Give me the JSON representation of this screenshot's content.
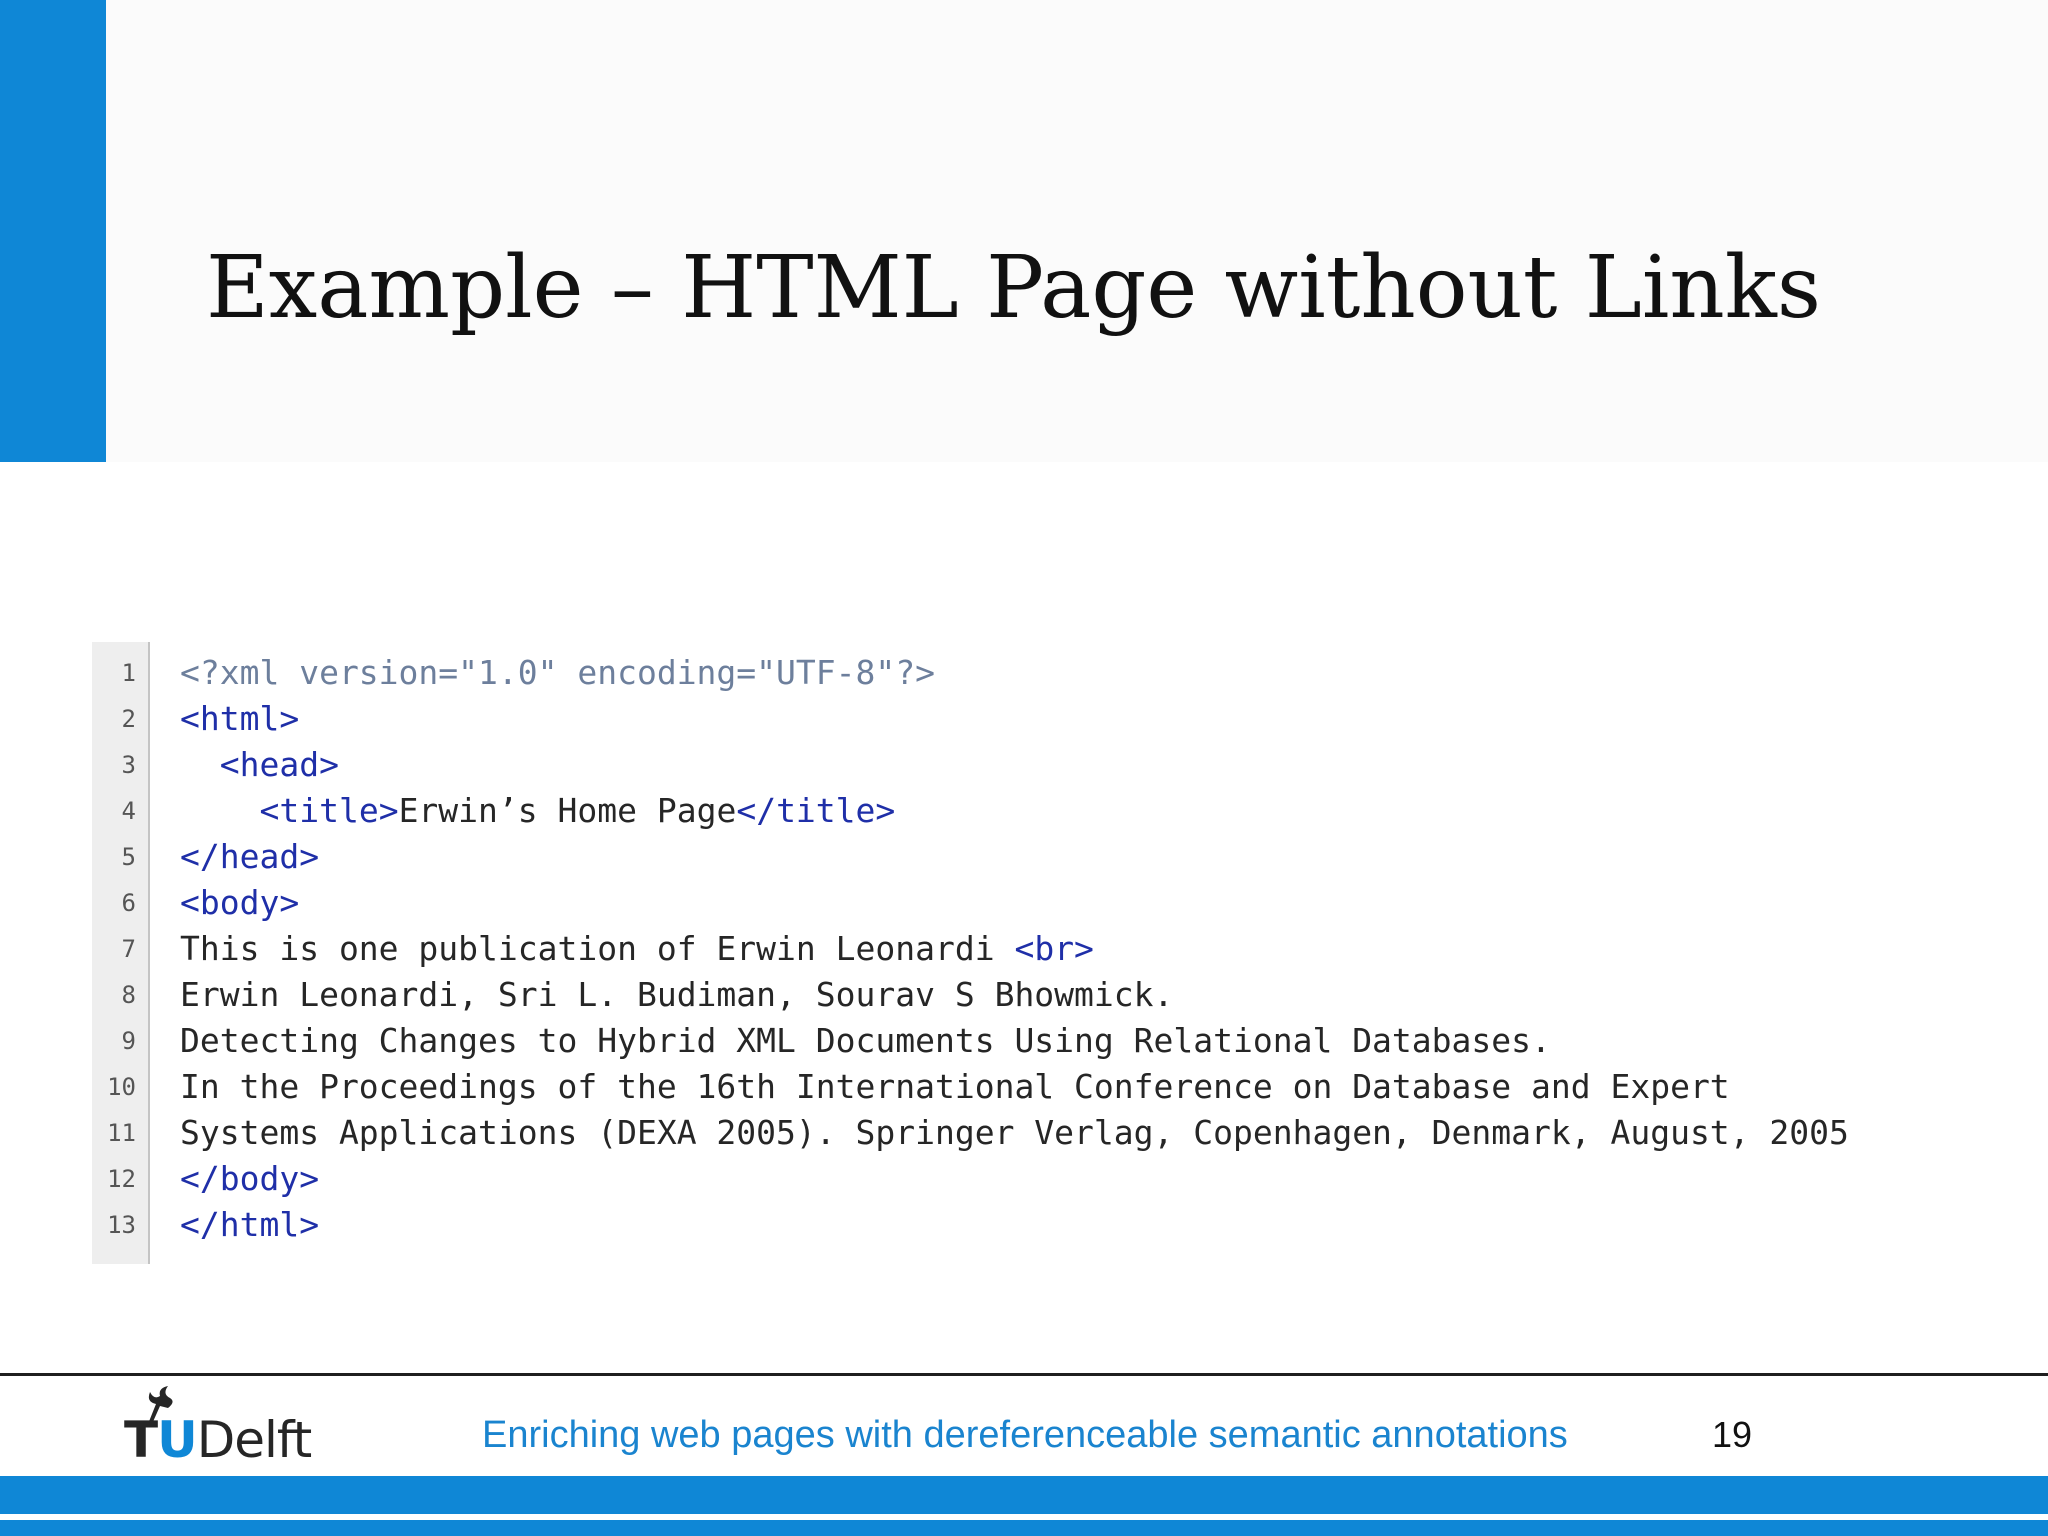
{
  "slide": {
    "title": "Example – HTML Page without Links",
    "accent_color": "#0f87d6"
  },
  "code": {
    "lines": [
      {
        "num": "1",
        "tokens": [
          {
            "t": "decl",
            "v": "<?xml version=\"1.0\" encoding=\"UTF-8\"?>"
          }
        ]
      },
      {
        "num": "2",
        "tokens": [
          {
            "t": "tag",
            "v": "<html>"
          }
        ]
      },
      {
        "num": "3",
        "tokens": [
          {
            "t": "text",
            "v": "  "
          },
          {
            "t": "tag",
            "v": "<head>"
          }
        ]
      },
      {
        "num": "4",
        "tokens": [
          {
            "t": "text",
            "v": "    "
          },
          {
            "t": "tag",
            "v": "<title>"
          },
          {
            "t": "text",
            "v": "Erwin’s Home Page"
          },
          {
            "t": "tag",
            "v": "</title>"
          }
        ]
      },
      {
        "num": "5",
        "tokens": [
          {
            "t": "tag",
            "v": "</head>"
          }
        ]
      },
      {
        "num": "6",
        "tokens": [
          {
            "t": "tag",
            "v": "<body>"
          }
        ]
      },
      {
        "num": "7",
        "tokens": [
          {
            "t": "text",
            "v": "This is one publication of Erwin Leonardi "
          },
          {
            "t": "tag",
            "v": "<br>"
          }
        ]
      },
      {
        "num": "8",
        "tokens": [
          {
            "t": "text",
            "v": "Erwin Leonardi, Sri L. Budiman, Sourav S Bhowmick."
          }
        ]
      },
      {
        "num": "9",
        "tokens": [
          {
            "t": "text",
            "v": "Detecting Changes to Hybrid XML Documents Using Relational Databases."
          }
        ]
      },
      {
        "num": "10",
        "tokens": [
          {
            "t": "text",
            "v": "In the Proceedings of the 16th International Conference on Database and Expert"
          }
        ]
      },
      {
        "num": "11",
        "tokens": [
          {
            "t": "text",
            "v": "Systems Applications (DEXA 2005). Springer Verlag, Copenhagen, Denmark, August, 2005"
          }
        ]
      },
      {
        "num": "12",
        "tokens": [
          {
            "t": "tag",
            "v": "</body>"
          }
        ]
      },
      {
        "num": "13",
        "tokens": [
          {
            "t": "tag",
            "v": "</html>"
          }
        ]
      }
    ],
    "colors": {
      "tag": "#1f2fa8",
      "decl": "#6d7f9c",
      "text": "#262626"
    }
  },
  "footer": {
    "logo": {
      "t": "T",
      "u": "U",
      "delft": "Delft",
      "icon": "flame-icon"
    },
    "caption": "Enriching web pages with dereferenceable semantic annotations",
    "page_number": "19"
  }
}
